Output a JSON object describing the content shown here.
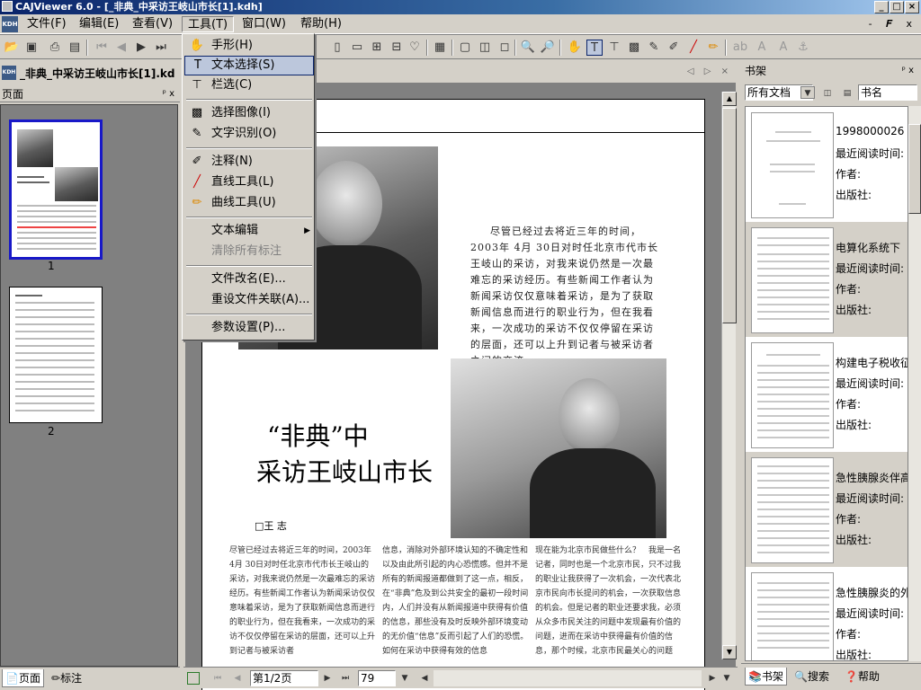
{
  "window": {
    "title": "CAJViewer 6.0 - [_非典_中采访王岐山市长[1].kdh]",
    "controls": [
      "_",
      "□",
      "×"
    ]
  },
  "menubar": {
    "logo": "KDH",
    "items": [
      "文件(F)",
      "编辑(E)",
      "查看(V)",
      "工具(T)",
      "窗口(W)",
      "帮助(H)"
    ],
    "mdi": "- 𝑭 x"
  },
  "tools_menu": {
    "items": [
      {
        "label": "手形(H)",
        "icon": "hand-icon"
      },
      {
        "label": "文本选择(S)",
        "icon": "text-select-icon"
      },
      {
        "label": "栏选(C)",
        "icon": "column-select-icon"
      },
      {
        "label": "选择图像(I)",
        "icon": "image-select-icon"
      },
      {
        "label": "文字识别(O)",
        "icon": "ocr-icon"
      },
      {
        "label": "注释(N)",
        "icon": "annotation-icon"
      },
      {
        "label": "直线工具(L)",
        "icon": "line-tool-icon"
      },
      {
        "label": "曲线工具(U)",
        "icon": "curve-tool-icon"
      },
      {
        "label": "文本编辑"
      },
      {
        "label": "清除所有标注"
      },
      {
        "label": "文件改名(E)..."
      },
      {
        "label": "重设文件关联(A)..."
      },
      {
        "label": "参数设置(P)..."
      }
    ]
  },
  "document": {
    "tab_title": "_非典_中采访王岐山市长[1].kd",
    "tab_nav": "◁ ▷ ×"
  },
  "left_panel": {
    "title": "页面",
    "pin": "ᵖ x",
    "pages": [
      "1",
      "2"
    ],
    "tabs": [
      "页面",
      "标注"
    ]
  },
  "article": {
    "headline_1": "“非典”中",
    "headline_2": "采访王岐山市长",
    "author": "□王  志",
    "intro": "尽管已经过去将近三年的时间，2003年 4月 30日对时任北京市代市长王岐山的采访，对我来说仍然是一次最难忘的采访经历。有些新闻工作者认为新闻采访仅仅意味着采访，是为了获取新闻信息而进行的职业行为，但在我看来，一次成功的采访不仅仅停留在采访的层面，还可以上升到记者与被采访者之间的交流。",
    "col1": "尽管已经过去将近三年的时间，2003年 4月 30日对时任北京市代市长王岐山的采访，对我来说仍然是一次最难忘的采访经历。有些新闻工作者认为新闻采访仅仅意味着采访，是为了获取新闻信息而进行的职业行为，但在我看来，一次成功的采访不仅仅停留在采访的层面，还可以上升到记者与被采访者",
    "col2": "信息，消除对外部环境认知的不确定性和以及由此所引起的内心恐慌感。但并不是所有的新闻报道都做到了这一点，相反，在“非典”危及到公共安全的最初一段时间内，人们并没有从新闻报道中获得有价值的信息，那些没有及时反映外部环境变动的无价值“信息”反而引起了人们的恐慌。　如何在采访中获得有效的信息",
    "col3": "现在能为北京市民做些什么？　我是一名记者，同时也是一个北京市民，只不过我的职业让我获得了一次机会，一次代表北京市民向市长提问的机会，一次获取信息的机会。但是记者的职业还要求我，必须从众多市民关注的问题中发现最有价值的问题，进而在采访中获得最有价值的信息，那个时候，北京市民最关心的问题"
  },
  "statusbar": {
    "page_field": "第1/2页",
    "zoom": "79"
  },
  "right_panel": {
    "title": "书架",
    "pin": "ᵖ x",
    "filter": "所有文档",
    "sort": "书名",
    "books": [
      {
        "title": "1998000026",
        "recent": "最近阅读时间:",
        "author": "作者:",
        "publisher": "出版社:"
      },
      {
        "title": "电算化系统下",
        "recent": "最近阅读时间:",
        "author": "作者:",
        "publisher": "出版社:"
      },
      {
        "title": "构建电子税收征",
        "recent": "最近阅读时间:",
        "author": "作者:",
        "publisher": "出版社:"
      },
      {
        "title": "急性胰腺炎伴高",
        "recent": "最近阅读时间:",
        "author": "作者:",
        "publisher": "出版社:"
      },
      {
        "title": "急性胰腺炎的外",
        "recent": "最近阅读时间:",
        "author": "作者:",
        "publisher": "出版社:"
      }
    ],
    "tabs": [
      "书架",
      "搜索",
      "帮助"
    ]
  }
}
